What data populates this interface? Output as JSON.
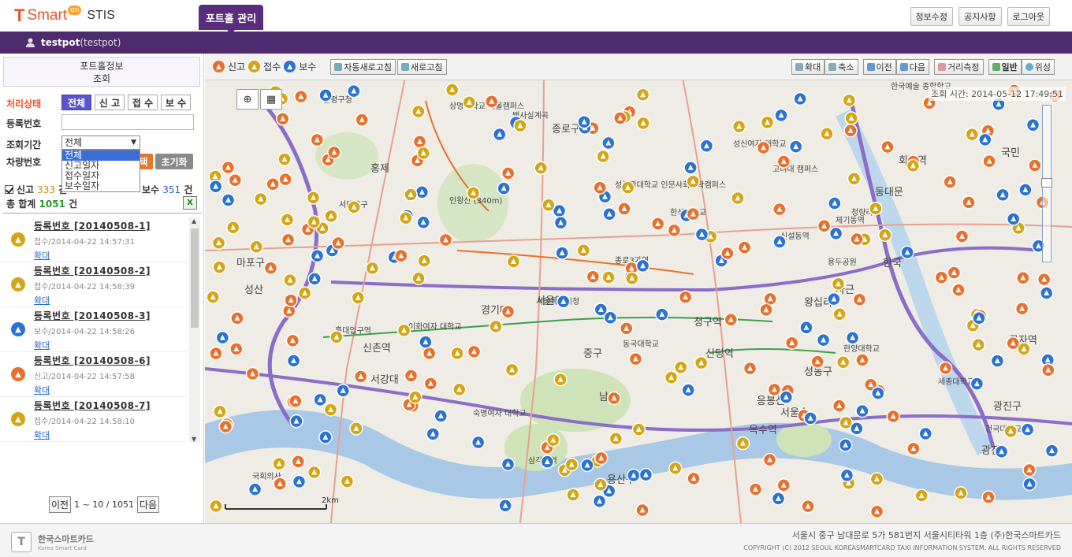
{
  "header": {
    "logo_t": "T",
    "logo_smart": "Smart",
    "logo_on": "on",
    "logo_stis": "STIS",
    "main_tab": "포트홀 관리",
    "buttons": [
      "정보수정",
      "공지사항",
      "로그아웃"
    ]
  },
  "user": {
    "id": "testpot",
    "name": "(testpot)"
  },
  "sidebar": {
    "title": "포트홀정보\n조회",
    "status_label": "처리상태",
    "status_options": [
      "전체",
      "신 고",
      "접 수",
      "보 수"
    ],
    "regno_label": "등록번호",
    "regno_value": "",
    "period_label": "조회기간",
    "period_selected": "전체",
    "period_options": [
      "전체",
      "신고일자",
      "접수일자",
      "보수일자"
    ],
    "vehicle_label": "차량번호",
    "search_btn": "택",
    "reset_btn": "초기화",
    "count_report_label": "신고",
    "count_report": "333",
    "count_report_unit": "건",
    "count_repair_label": "보수",
    "count_repair": "351",
    "count_repair_unit": "건",
    "total_label": "총 합계",
    "total": "1051",
    "total_unit": "건",
    "items": [
      {
        "reg": "등록번호 [20140508-1]",
        "meta": "접수/2014-04-22 14:57:31",
        "zoom": "확대",
        "type": "accept"
      },
      {
        "reg": "등록번호 [20140508-2]",
        "meta": "접수/2014-04-22 14:58:39",
        "zoom": "확대",
        "type": "accept"
      },
      {
        "reg": "등록번호 [20140508-3]",
        "meta": "보수/2014-04-22 14:58:26",
        "zoom": "확대",
        "type": "repair"
      },
      {
        "reg": "등록번호 [20140508-6]",
        "meta": "신고/2014-04-22 14:57:58",
        "zoom": "확대",
        "type": "report"
      },
      {
        "reg": "등록번호 [20140508-7]",
        "meta": "접수/2014-04-22 14:58:10",
        "zoom": "확대",
        "type": "accept"
      }
    ],
    "pager": {
      "prev": "이전",
      "range": "1 ~ 10 / 1051",
      "next": "다음"
    }
  },
  "map": {
    "legend": [
      "신고",
      "접수",
      "보수"
    ],
    "auto_refresh": "자동새로고침",
    "refresh": "새로고침",
    "zoom_in": "확대",
    "zoom_out": "축소",
    "prev": "이전",
    "next": "다음",
    "measure": "거리측정",
    "normal": "일반",
    "satellite": "위성",
    "timestamp_label": "조회 시간:",
    "timestamp": "2014-05-12 17:49:51",
    "scale": "2km",
    "labels": [
      "은평구청",
      "상명대학교 서울캠퍼스",
      "백사실계곡",
      "종로구",
      "서대문구",
      "인왕산 (340m)",
      "성균관대학교 인문사회과학캠퍼스",
      "한성대학교",
      "성신여자 대학교",
      "고려대 캠퍼스",
      "한국예술 종합학교",
      "회기역",
      "동대문",
      "제기동역",
      "청량리역",
      "신설동역",
      "용두공원",
      "종로3가역",
      "서울특별시청",
      "이화여자 대학교",
      "경기대",
      "홍대입구역",
      "신촌역",
      "중구",
      "동국대학교",
      "청구역",
      "신당역",
      "한양대학교",
      "성동구",
      "세종대학교",
      "광진구",
      "서강대",
      "남산",
      "응봉산",
      "서울숲",
      "왕십리",
      "숙명여자 대학교",
      "삼각지역",
      "용산구",
      "옥수역",
      "국회의사",
      "마포구",
      "군자역",
      "건국대학교",
      "광진",
      "한국",
      "국민",
      "홍제",
      "성산",
      "사근",
      "서울역"
    ],
    "colors": {
      "report": "#e8702a",
      "accept": "#d4a514",
      "repair": "#2a72d4"
    }
  },
  "footer": {
    "logo_mark": "T",
    "company": "한국스마트카드",
    "company_en": "Korea Smart Card",
    "address": "서울시 중구 남대문로 5가 581번지 서울시티타워 1층 (주)한국스마트카드",
    "copyright": "COPYRIGHT (C) 2012 SEOUL KOREASMARTCARD TAXI INFORMATION SYSTEM. ALL RIGHTS RESERVED"
  }
}
